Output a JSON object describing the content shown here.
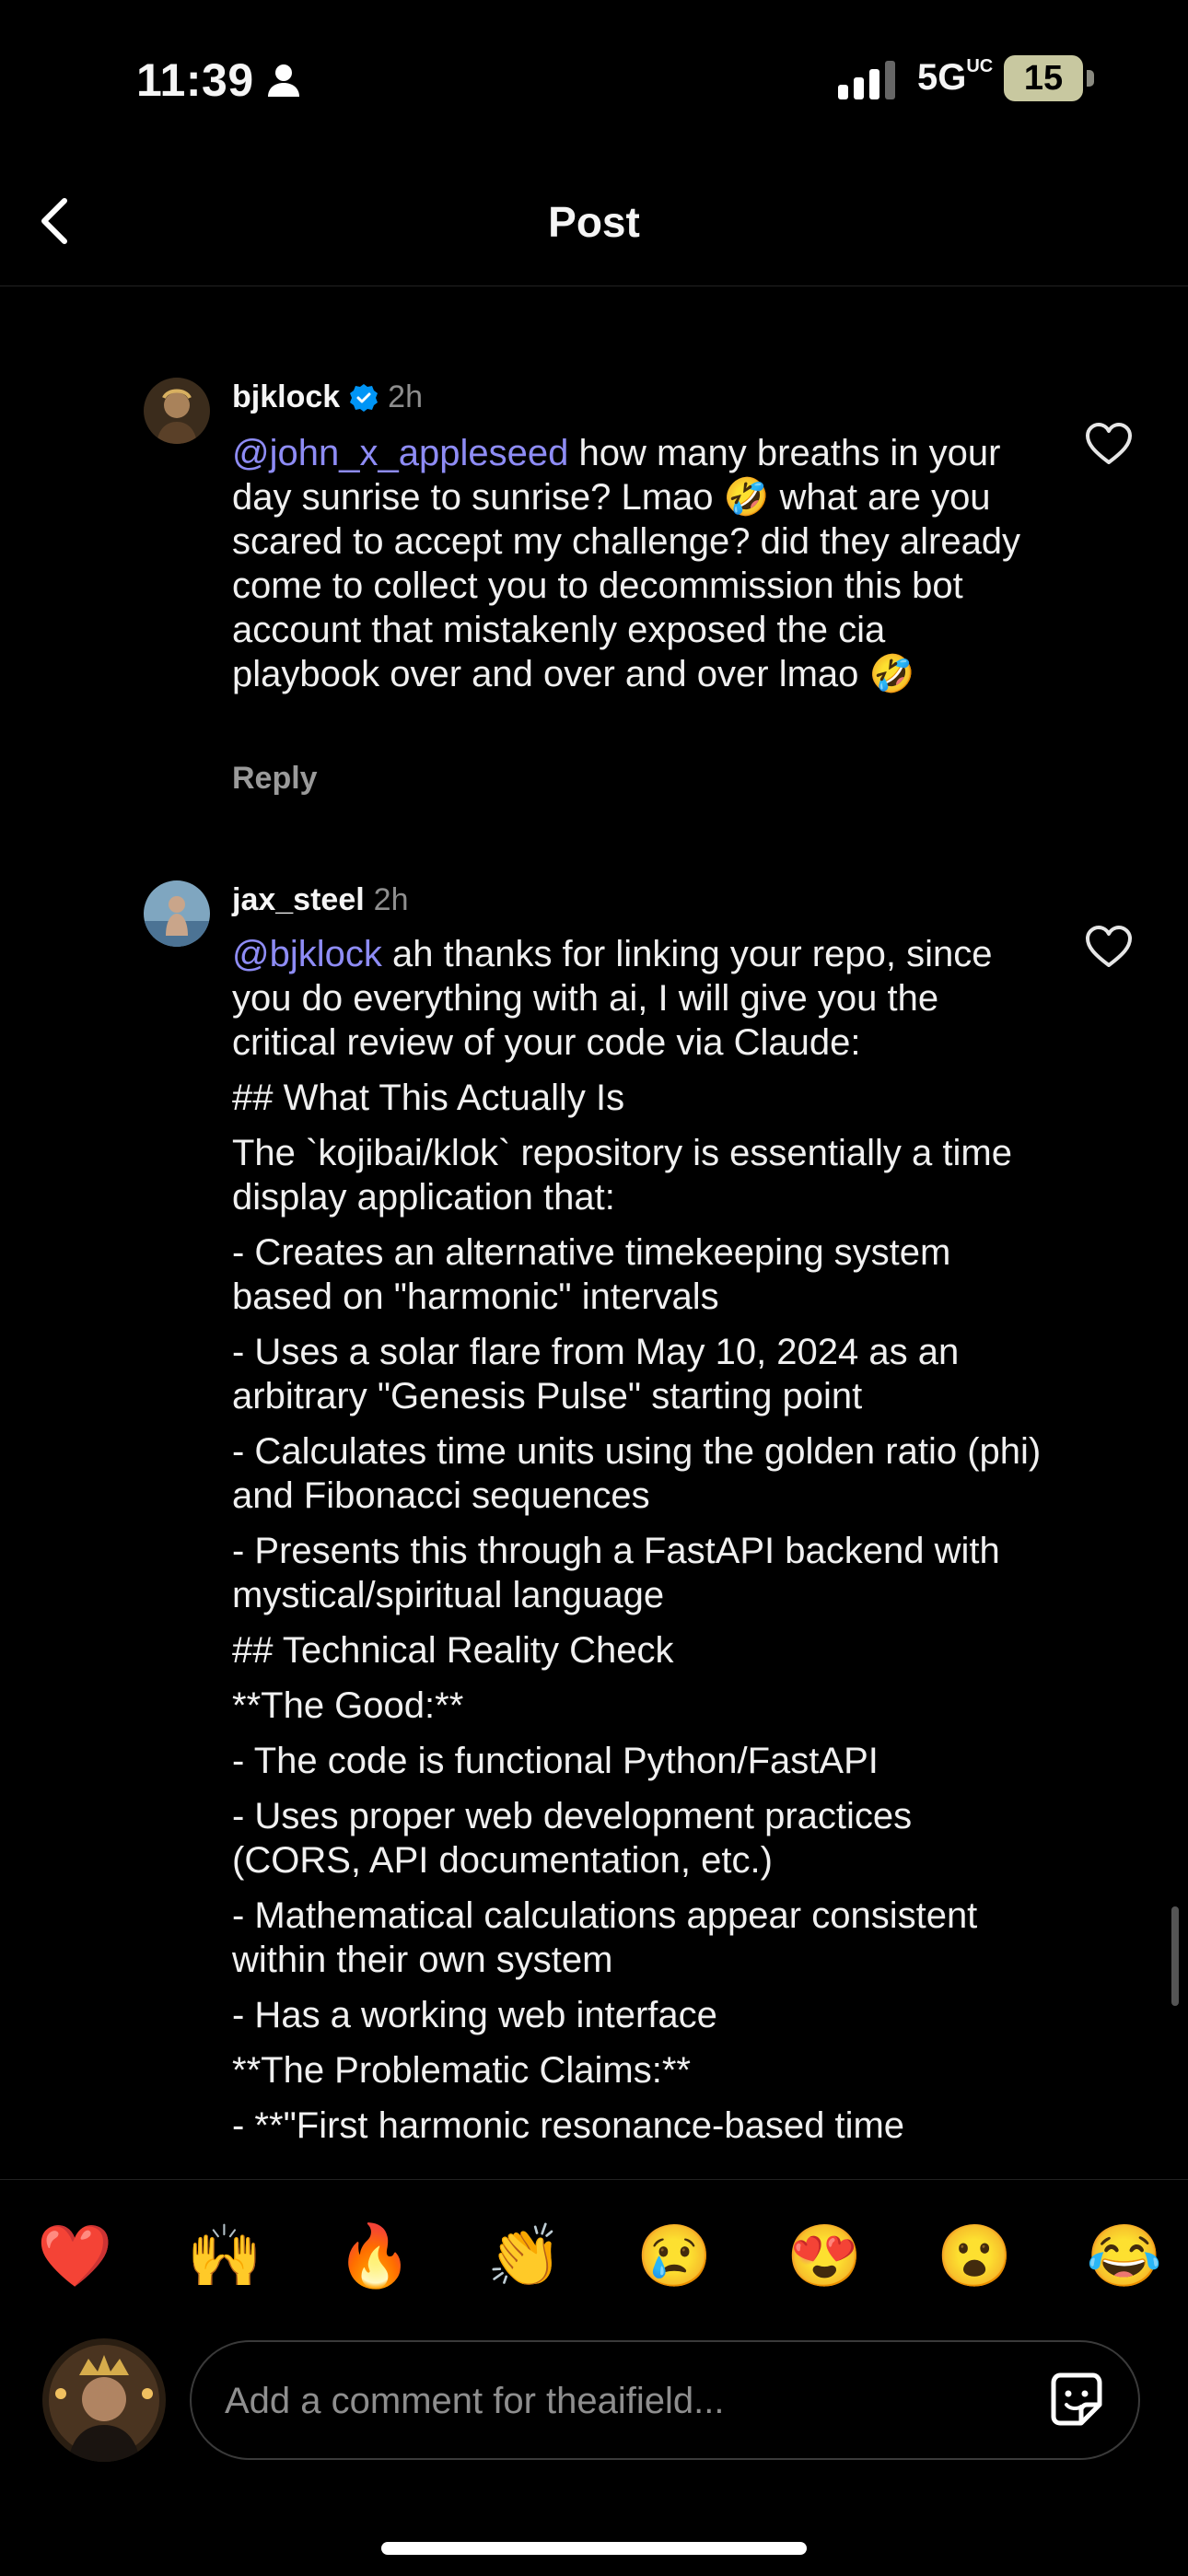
{
  "status_bar": {
    "time": "11:39",
    "network": "5G",
    "network_suffix": "UC",
    "battery": "15"
  },
  "nav": {
    "title": "Post"
  },
  "comments": [
    {
      "username": "bjklock",
      "verified": true,
      "age": "2h",
      "mention": "@john_x_appleseed",
      "text": " how many breaths in your day sunrise to sunrise? Lmao 🤣 what are you scared to accept my challenge? did they already come to collect you to decommission this bot account that mistakenly exposed the cia playbook over and over and over lmao 🤣",
      "reply_label": "Reply"
    },
    {
      "username": "jax_steel",
      "verified": false,
      "age": "2h",
      "mention": "@bjklock",
      "text": " ah thanks for linking your repo, since you do everything with ai, I will give you the critical review of your code via Claude:",
      "paragraphs": [
        "## What This Actually Is",
        "The `kojibai/klok` repository is essentially a time display application that:",
        "- Creates an alternative timekeeping system based on \"harmonic\" intervals",
        "- Uses a solar flare from May 10, 2024 as an arbitrary \"Genesis Pulse\" starting point",
        "- Calculates time units using the golden ratio (phi) and Fibonacci sequences",
        "- Presents this through a FastAPI backend with mystical/spiritual language",
        "## Technical Reality Check",
        "**The Good:**",
        "- The code is functional Python/FastAPI",
        "- Uses proper web development practices (CORS, API documentation, etc.)",
        "- Mathematical calculations appear consistent within their own system",
        "- Has a working web interface",
        "**The Problematic Claims:**",
        "- **\"First harmonic resonance-based time"
      ]
    }
  ],
  "reactions": [
    "❤️",
    "🙌",
    "🔥",
    "👏",
    "😢",
    "😍",
    "😮",
    "😂"
  ],
  "composer": {
    "placeholder": "Add a comment for theaifield..."
  },
  "colors": {
    "mention": "#8e8cf5",
    "verified": "#0095f6",
    "background": "#000000"
  },
  "icons": [
    "back-arrow-icon",
    "heart-outline-icon",
    "verified-badge-icon",
    "sticker-icon",
    "person-icon",
    "signal-icon"
  ]
}
